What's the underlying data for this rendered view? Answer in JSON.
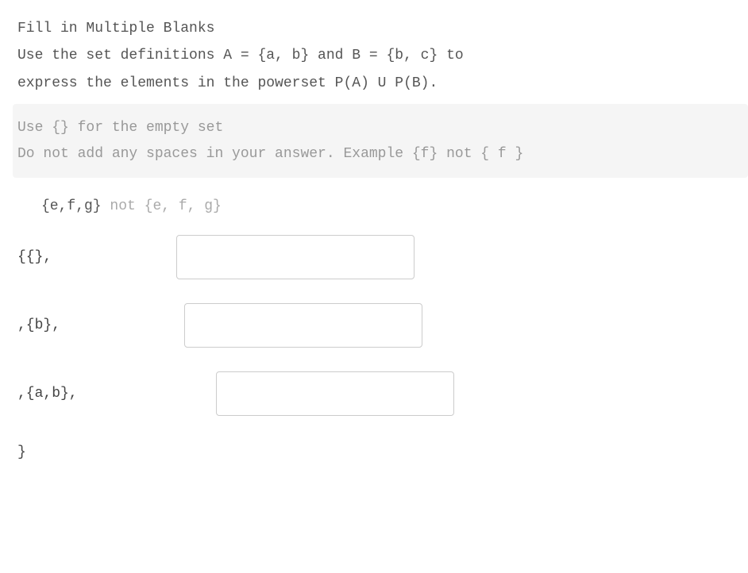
{
  "title": "Fill in Multiple Blanks",
  "prompt_line1": "Use the set definitions A = {a, b} and B = {b, c} to",
  "prompt_line2": "express the elements in the powerset P(A) U P(B).",
  "hint": {
    "line1": "Use {} for the empty set",
    "line2": "Do not add any spaces in your answer.  Example  {f}  not { f  }"
  },
  "example": {
    "good": "{e,f,g}",
    "sep": " not ",
    "bad": "{e, f, g}"
  },
  "blanks": {
    "prefix1": "{{},",
    "prefix2": ",{b},",
    "prefix3": ",{a,b},",
    "closing": "}",
    "value1": "",
    "value2": "",
    "value3": ""
  }
}
